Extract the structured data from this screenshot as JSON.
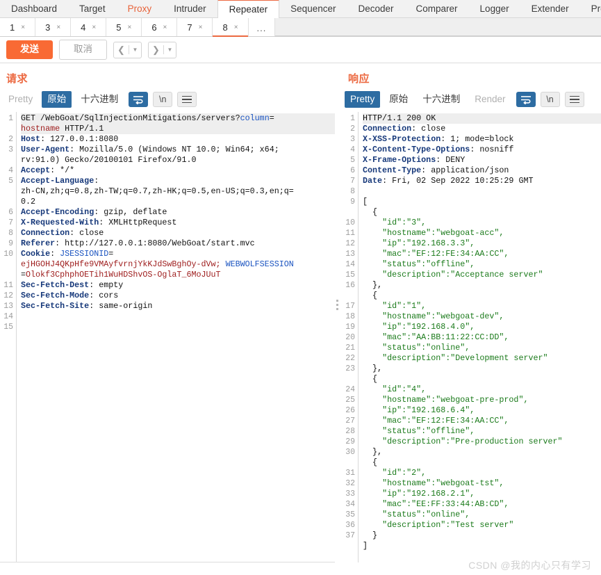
{
  "main_tabs": [
    {
      "label": "Dashboard",
      "state": "normal"
    },
    {
      "label": "Target",
      "state": "normal"
    },
    {
      "label": "Proxy",
      "state": "accent"
    },
    {
      "label": "Intruder",
      "state": "normal"
    },
    {
      "label": "Repeater",
      "state": "selected"
    },
    {
      "label": "Sequencer",
      "state": "normal"
    },
    {
      "label": "Decoder",
      "state": "normal"
    },
    {
      "label": "Comparer",
      "state": "normal"
    },
    {
      "label": "Logger",
      "state": "normal"
    },
    {
      "label": "Extender",
      "state": "normal"
    },
    {
      "label": "Pro",
      "state": "normal"
    }
  ],
  "repeater_tabs": [
    {
      "label": "1",
      "close": "×",
      "selected": false
    },
    {
      "label": "3",
      "close": "×",
      "selected": false
    },
    {
      "label": "4",
      "close": "×",
      "selected": false
    },
    {
      "label": "5",
      "close": "×",
      "selected": false
    },
    {
      "label": "6",
      "close": "×",
      "selected": false
    },
    {
      "label": "7",
      "close": "×",
      "selected": false
    },
    {
      "label": "8",
      "close": "×",
      "selected": true
    }
  ],
  "repeater_more_label": "...",
  "toolbar": {
    "send_label": "发送",
    "cancel_label": "取消",
    "back_arrow": "❮",
    "forward_arrow": "❯",
    "caret": "▼"
  },
  "request": {
    "title": "请求",
    "views": [
      {
        "label": "Pretty",
        "state": "muted"
      },
      {
        "label": "原始",
        "state": "active"
      },
      {
        "label": "十六进制",
        "state": "normal"
      }
    ],
    "wrap_icon": "wrap-lines-icon",
    "newline_label": "\\n",
    "menu_icon": "hamburger-icon",
    "line_numbers": [
      "1",
      "2",
      "3",
      "",
      "4",
      "5",
      "",
      "",
      "6",
      "7",
      "8",
      "9",
      "10",
      "",
      "",
      "11",
      "12",
      "13",
      "14",
      "15"
    ],
    "lines": [
      {
        "num": "1",
        "hl": true,
        "segs": [
          {
            "t": "GET /WebGoat/SqlInjectionMitigations/servers?",
            "c": "plain"
          },
          {
            "t": "column",
            "c": "kq"
          },
          {
            "t": "=",
            "c": "plain"
          }
        ]
      },
      {
        "num": "",
        "hl": true,
        "segs": [
          {
            "t": "hostname",
            "c": "kr"
          },
          {
            "t": " HTTP/1.1",
            "c": "plain"
          }
        ]
      },
      {
        "num": "2",
        "hl": false,
        "segs": [
          {
            "t": "Host",
            "c": "hdr"
          },
          {
            "t": ": 127.0.0.1:8080",
            "c": "plain"
          }
        ]
      },
      {
        "num": "3",
        "hl": false,
        "segs": [
          {
            "t": "User-Agent",
            "c": "hdr"
          },
          {
            "t": ": Mozilla/5.0 (Windows NT 10.0; Win64; x64;",
            "c": "plain"
          }
        ]
      },
      {
        "num": "",
        "hl": false,
        "segs": [
          {
            "t": "rv:91.0) Gecko/20100101 Firefox/91.0",
            "c": "plain"
          }
        ]
      },
      {
        "num": "4",
        "hl": false,
        "segs": [
          {
            "t": "Accept",
            "c": "hdr"
          },
          {
            "t": ": */*",
            "c": "plain"
          }
        ]
      },
      {
        "num": "5",
        "hl": false,
        "segs": [
          {
            "t": "Accept-Language",
            "c": "hdr"
          },
          {
            "t": ":",
            "c": "plain"
          }
        ]
      },
      {
        "num": "",
        "hl": false,
        "segs": [
          {
            "t": "zh-CN,zh;q=0.8,zh-TW;q=0.7,zh-HK;q=0.5,en-US;q=0.3,en;q=",
            "c": "plain"
          }
        ]
      },
      {
        "num": "",
        "hl": false,
        "segs": [
          {
            "t": "0.2",
            "c": "plain"
          }
        ]
      },
      {
        "num": "6",
        "hl": false,
        "segs": [
          {
            "t": "Accept-Encoding",
            "c": "hdr"
          },
          {
            "t": ": gzip, deflate",
            "c": "plain"
          }
        ]
      },
      {
        "num": "7",
        "hl": false,
        "segs": [
          {
            "t": "X-Requested-With",
            "c": "hdr"
          },
          {
            "t": ": XMLHttpRequest",
            "c": "plain"
          }
        ]
      },
      {
        "num": "8",
        "hl": false,
        "segs": [
          {
            "t": "Connection",
            "c": "hdr"
          },
          {
            "t": ": close",
            "c": "plain"
          }
        ]
      },
      {
        "num": "9",
        "hl": false,
        "segs": [
          {
            "t": "Referer",
            "c": "hdr"
          },
          {
            "t": ": http://127.0.0.1:8080/WebGoat/start.mvc",
            "c": "plain"
          }
        ]
      },
      {
        "num": "10",
        "hl": false,
        "segs": [
          {
            "t": "Cookie",
            "c": "hdr"
          },
          {
            "t": ": ",
            "c": "plain"
          },
          {
            "t": "JSESSIONID",
            "c": "kq"
          },
          {
            "t": "=",
            "c": "plain"
          }
        ]
      },
      {
        "num": "",
        "hl": false,
        "segs": [
          {
            "t": "ejHGOHJ4QKpHfe9VMAyfvrnjYkKJdSwBghOy-dVw;",
            "c": "kr"
          },
          {
            "t": " ",
            "c": "plain"
          },
          {
            "t": "WEBWOLFSESSION",
            "c": "kq"
          }
        ]
      },
      {
        "num": "",
        "hl": false,
        "segs": [
          {
            "t": "=",
            "c": "plain"
          },
          {
            "t": "Olokf3CphphOETih1WuHDShvOS-OglaT_6MoJUuT",
            "c": "kr"
          }
        ]
      },
      {
        "num": "11",
        "hl": false,
        "segs": [
          {
            "t": "Sec-Fetch-Dest",
            "c": "hdr"
          },
          {
            "t": ": empty",
            "c": "plain"
          }
        ]
      },
      {
        "num": "12",
        "hl": false,
        "segs": [
          {
            "t": "Sec-Fetch-Mode",
            "c": "hdr"
          },
          {
            "t": ": cors",
            "c": "plain"
          }
        ]
      },
      {
        "num": "13",
        "hl": false,
        "segs": [
          {
            "t": "Sec-Fetch-Site",
            "c": "hdr"
          },
          {
            "t": ": same-origin",
            "c": "plain"
          }
        ]
      },
      {
        "num": "14",
        "hl": false,
        "segs": []
      },
      {
        "num": "15",
        "hl": false,
        "segs": []
      }
    ]
  },
  "response": {
    "title": "响应",
    "views": [
      {
        "label": "Pretty",
        "state": "active"
      },
      {
        "label": "原始",
        "state": "normal"
      },
      {
        "label": "十六进制",
        "state": "normal"
      },
      {
        "label": "Render",
        "state": "muted"
      }
    ],
    "wrap_icon": "wrap-lines-icon",
    "newline_label": "\\n",
    "menu_icon": "hamburger-icon",
    "lines": [
      {
        "num": "1",
        "hl": true,
        "segs": [
          {
            "t": "HTTP/1.1 200 OK",
            "c": "plain"
          }
        ]
      },
      {
        "num": "2",
        "hl": false,
        "segs": [
          {
            "t": "Connection",
            "c": "hdr"
          },
          {
            "t": ": close",
            "c": "plain"
          }
        ]
      },
      {
        "num": "3",
        "hl": false,
        "segs": [
          {
            "t": "X-XSS-Protection",
            "c": "hdr"
          },
          {
            "t": ": 1; mode=block",
            "c": "plain"
          }
        ]
      },
      {
        "num": "4",
        "hl": false,
        "segs": [
          {
            "t": "X-Content-Type-Options",
            "c": "hdr"
          },
          {
            "t": ": nosniff",
            "c": "plain"
          }
        ]
      },
      {
        "num": "5",
        "hl": false,
        "segs": [
          {
            "t": "X-Frame-Options",
            "c": "hdr"
          },
          {
            "t": ": DENY",
            "c": "plain"
          }
        ]
      },
      {
        "num": "6",
        "hl": false,
        "segs": [
          {
            "t": "Content-Type",
            "c": "hdr"
          },
          {
            "t": ": application/json",
            "c": "plain"
          }
        ]
      },
      {
        "num": "7",
        "hl": false,
        "segs": [
          {
            "t": "Date",
            "c": "hdr"
          },
          {
            "t": ": Fri, 02 Sep 2022 10:25:29 GMT",
            "c": "plain"
          }
        ]
      },
      {
        "num": "8",
        "hl": false,
        "segs": []
      },
      {
        "num": "9",
        "hl": false,
        "segs": [
          {
            "t": "[",
            "c": "plain"
          }
        ]
      },
      {
        "num": "",
        "hl": false,
        "segs": [
          {
            "t": "  {",
            "c": "plain"
          }
        ]
      },
      {
        "num": "10",
        "hl": false,
        "segs": [
          {
            "t": "    \"id\":\"3\",",
            "c": "json"
          }
        ]
      },
      {
        "num": "11",
        "hl": false,
        "segs": [
          {
            "t": "    \"hostname\":\"webgoat-acc\",",
            "c": "json"
          }
        ]
      },
      {
        "num": "12",
        "hl": false,
        "segs": [
          {
            "t": "    \"ip\":\"192.168.3.3\",",
            "c": "json"
          }
        ]
      },
      {
        "num": "13",
        "hl": false,
        "segs": [
          {
            "t": "    \"mac\":\"EF:12:FE:34:AA:CC\",",
            "c": "json"
          }
        ]
      },
      {
        "num": "14",
        "hl": false,
        "segs": [
          {
            "t": "    \"status\":\"offline\",",
            "c": "json"
          }
        ]
      },
      {
        "num": "15",
        "hl": false,
        "segs": [
          {
            "t": "    \"description\":\"Acceptance server\"",
            "c": "json"
          }
        ]
      },
      {
        "num": "16",
        "hl": false,
        "segs": [
          {
            "t": "  },",
            "c": "plain"
          }
        ]
      },
      {
        "num": "",
        "hl": false,
        "segs": [
          {
            "t": "  {",
            "c": "plain"
          }
        ]
      },
      {
        "num": "17",
        "hl": false,
        "segs": [
          {
            "t": "    \"id\":\"1\",",
            "c": "json"
          }
        ]
      },
      {
        "num": "18",
        "hl": false,
        "segs": [
          {
            "t": "    \"hostname\":\"webgoat-dev\",",
            "c": "json"
          }
        ]
      },
      {
        "num": "19",
        "hl": false,
        "segs": [
          {
            "t": "    \"ip\":\"192.168.4.0\",",
            "c": "json"
          }
        ]
      },
      {
        "num": "20",
        "hl": false,
        "segs": [
          {
            "t": "    \"mac\":\"AA:BB:11:22:CC:DD\",",
            "c": "json"
          }
        ]
      },
      {
        "num": "21",
        "hl": false,
        "segs": [
          {
            "t": "    \"status\":\"online\",",
            "c": "json"
          }
        ]
      },
      {
        "num": "22",
        "hl": false,
        "segs": [
          {
            "t": "    \"description\":\"Development server\"",
            "c": "json"
          }
        ]
      },
      {
        "num": "23",
        "hl": false,
        "segs": [
          {
            "t": "  },",
            "c": "plain"
          }
        ]
      },
      {
        "num": "",
        "hl": false,
        "segs": [
          {
            "t": "  {",
            "c": "plain"
          }
        ]
      },
      {
        "num": "24",
        "hl": false,
        "segs": [
          {
            "t": "    \"id\":\"4\",",
            "c": "json"
          }
        ]
      },
      {
        "num": "25",
        "hl": false,
        "segs": [
          {
            "t": "    \"hostname\":\"webgoat-pre-prod\",",
            "c": "json"
          }
        ]
      },
      {
        "num": "26",
        "hl": false,
        "segs": [
          {
            "t": "    \"ip\":\"192.168.6.4\",",
            "c": "json"
          }
        ]
      },
      {
        "num": "27",
        "hl": false,
        "segs": [
          {
            "t": "    \"mac\":\"EF:12:FE:34:AA:CC\",",
            "c": "json"
          }
        ]
      },
      {
        "num": "28",
        "hl": false,
        "segs": [
          {
            "t": "    \"status\":\"offline\",",
            "c": "json"
          }
        ]
      },
      {
        "num": "29",
        "hl": false,
        "segs": [
          {
            "t": "    \"description\":\"Pre-production server\"",
            "c": "json"
          }
        ]
      },
      {
        "num": "30",
        "hl": false,
        "segs": [
          {
            "t": "  },",
            "c": "plain"
          }
        ]
      },
      {
        "num": "",
        "hl": false,
        "segs": [
          {
            "t": "  {",
            "c": "plain"
          }
        ]
      },
      {
        "num": "31",
        "hl": false,
        "segs": [
          {
            "t": "    \"id\":\"2\",",
            "c": "json"
          }
        ]
      },
      {
        "num": "32",
        "hl": false,
        "segs": [
          {
            "t": "    \"hostname\":\"webgoat-tst\",",
            "c": "json"
          }
        ]
      },
      {
        "num": "33",
        "hl": false,
        "segs": [
          {
            "t": "    \"ip\":\"192.168.2.1\",",
            "c": "json"
          }
        ]
      },
      {
        "num": "34",
        "hl": false,
        "segs": [
          {
            "t": "    \"mac\":\"EE:FF:33:44:AB:CD\",",
            "c": "json"
          }
        ]
      },
      {
        "num": "35",
        "hl": false,
        "segs": [
          {
            "t": "    \"status\":\"online\",",
            "c": "json"
          }
        ]
      },
      {
        "num": "36",
        "hl": false,
        "segs": [
          {
            "t": "    \"description\":\"Test server\"",
            "c": "json"
          }
        ]
      },
      {
        "num": "37",
        "hl": false,
        "segs": [
          {
            "t": "  }",
            "c": "plain"
          }
        ]
      },
      {
        "num": "",
        "hl": false,
        "segs": [
          {
            "t": "]",
            "c": "plain"
          }
        ]
      }
    ]
  },
  "watermark": "CSDN @我的内心只有学习",
  "colors": {
    "accent_orange": "#ec6941",
    "send_orange": "#f96a34",
    "select_blue": "#2d6ca2",
    "header_blue": "#16387a",
    "json_green": "#1a7a1a",
    "cookie_red": "#9d1b1b"
  }
}
